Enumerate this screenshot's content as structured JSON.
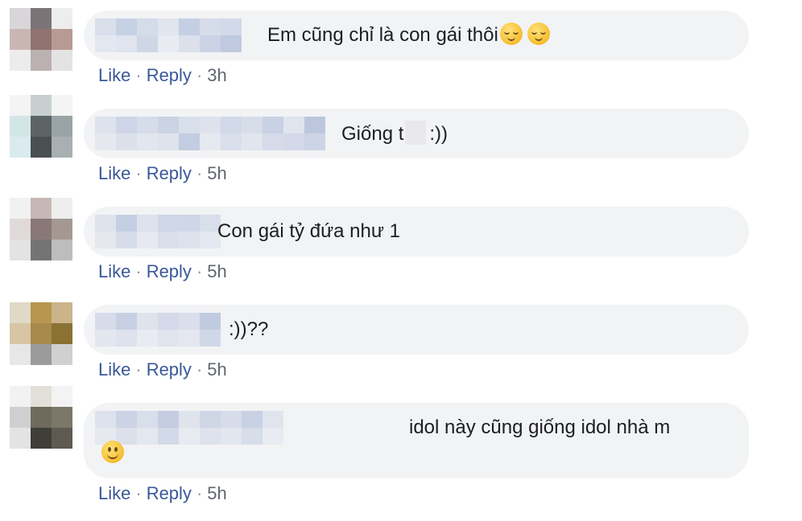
{
  "colors": {
    "link": "#385898",
    "bubble": "#f2f3f5",
    "timestamp": "#616770",
    "text": "#1c1e21"
  },
  "comments": [
    {
      "text": "Em cũng chỉ là con gái thôi",
      "trailing_emoji": [
        "relieved-face-icon",
        "relieved-face-icon"
      ],
      "like": "Like",
      "reply": "Reply",
      "time": "3h"
    },
    {
      "text_before": "Giống t",
      "text_after": ":))",
      "like": "Like",
      "reply": "Reply",
      "time": "5h"
    },
    {
      "text": "Con gái tỷ đứa như 1",
      "like": "Like",
      "reply": "Reply",
      "time": "5h"
    },
    {
      "text": ":))??",
      "like": "Like",
      "reply": "Reply",
      "time": "5h"
    },
    {
      "text": "idol này cũng giống idol nhà m",
      "trailing_emoji": [
        "slightly-smiling-face-icon"
      ],
      "like": "Like",
      "reply": "Reply",
      "time": "5h"
    }
  ]
}
